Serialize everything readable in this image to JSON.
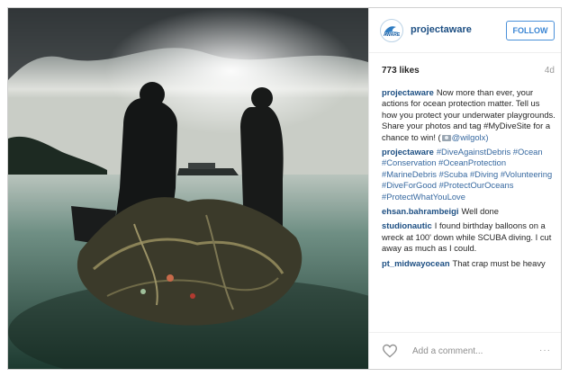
{
  "post": {
    "username": "projectaware",
    "avatar_text": "AWARE",
    "follow_label": "FOLLOW",
    "likes": "773 likes",
    "age": "4d",
    "caption": {
      "user": "projectaware",
      "text": "Now more than ever, your actions for ocean protection matter. Tell us how you protect your underwater playgrounds. Share your photos and tag #MyDiveSite for a chance to win! (",
      "text_end": "@wilgolx)"
    },
    "comments": [
      {
        "user": "projectaware",
        "text": "#DiveAgainstDebris #Ocean #Conservation #OceanProtection #MarineDebris #Scuba #Diving #Volunteering #DiveForGood #ProtectOurOceans #ProtectWhatYouLove"
      },
      {
        "user": "ehsan.bahrambeigi",
        "text": "Well done"
      },
      {
        "user": "studionautic",
        "text": "I found birthday balloons on a wreck at 100' down while SCUBA diving. I cut away as much as I could."
      },
      {
        "user": "pt_midwayocean",
        "text": "That crap must be heavy"
      }
    ],
    "add_comment_placeholder": "Add a comment...",
    "more_label": "···"
  },
  "colors": {
    "link": "#3769a0",
    "username": "#1d4f83",
    "follow": "#3b86d4"
  },
  "icons": {
    "like": "heart-icon",
    "camera": "camera-icon",
    "more": "more-options-icon"
  }
}
